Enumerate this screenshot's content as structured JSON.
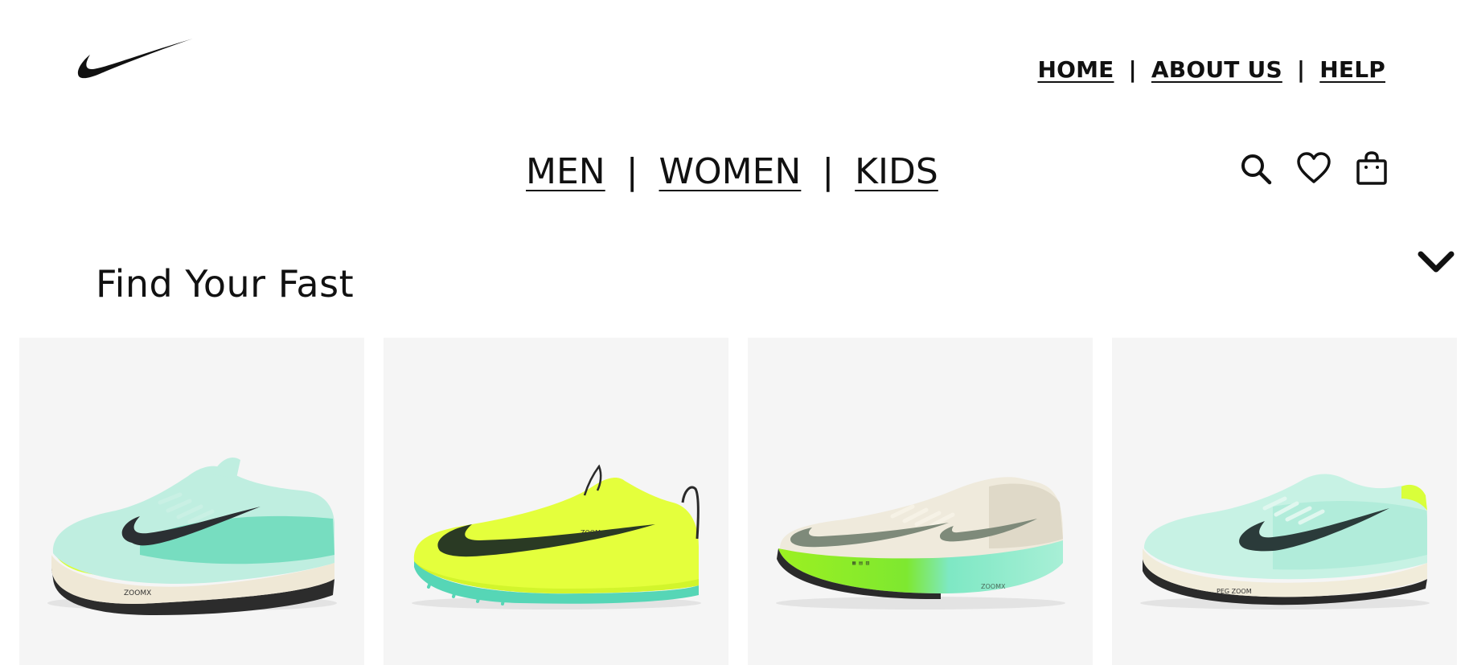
{
  "brand": {
    "logo": "swoosh-logo"
  },
  "top_nav": {
    "items": [
      "HOME",
      "ABOUT US",
      "HELP"
    ],
    "separator": "|"
  },
  "category_nav": {
    "items": [
      "MEN",
      "WOMEN",
      "KIDS"
    ],
    "separator": "|"
  },
  "actions": {
    "icons": [
      "search-icon",
      "heart-icon",
      "shopping-bag-icon"
    ]
  },
  "section": {
    "title": "Find Your Fast",
    "toggle_icon": "chevron-down-icon"
  },
  "products": [
    {
      "image": "running-shoe-mint-volt",
      "colors": {
        "upper": "#bfeee0",
        "accent": "#3ccfa6",
        "midsole": "#f0ead8",
        "volt": "#d9ff3a",
        "swoosh": "#2b2f33"
      }
    },
    {
      "image": "track-spike-volt",
      "colors": {
        "upper": "#e4ff3c",
        "accent": "#d2f52c",
        "midsole": "#56d6b6",
        "volt": "#e4ff3c",
        "swoosh": "#2a3a24"
      }
    },
    {
      "image": "racing-shoe-sail-volt",
      "colors": {
        "upper": "#efeadc",
        "accent": "#d8d2bf",
        "midsole": "#7ee8c4",
        "volt": "#9cf021",
        "swoosh": "#7e8a7a"
      }
    },
    {
      "image": "running-shoe-mint-sail",
      "colors": {
        "upper": "#c7f2e4",
        "accent": "#9ee7d1",
        "midsole": "#f1ecda",
        "volt": "#d9ff3a",
        "swoosh": "#2b3b3a"
      }
    }
  ]
}
